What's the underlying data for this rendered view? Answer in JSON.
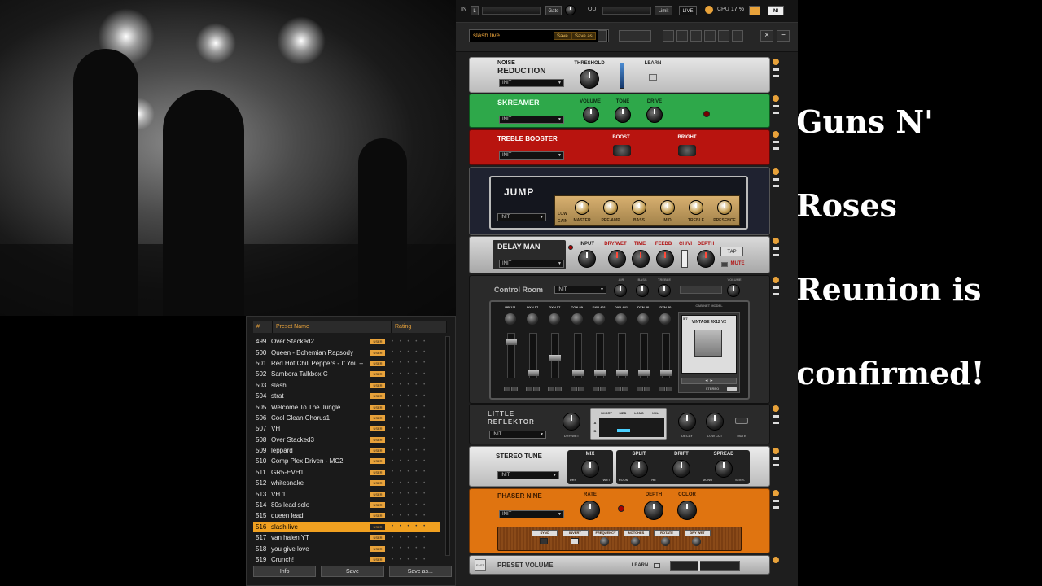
{
  "headline": {
    "lines": [
      "Guns N'",
      "Roses",
      "Reunion is",
      "confirmed!"
    ]
  },
  "topbar": {
    "in_label": "IN",
    "in_channel": "L",
    "gate_label": "Gate",
    "out_label": "OUT",
    "limit_label": "Limit",
    "live_label": "LIVE",
    "cpu_label": "CPU",
    "cpu_value": "17 %",
    "logo": "NI"
  },
  "preset_bar": {
    "preset_name": "slash live",
    "save_label": "Save",
    "save_as_label": "Save as"
  },
  "browser": {
    "col_num": "#",
    "col_name": "Preset Name",
    "col_rating": "Rating",
    "user_tag": "USER",
    "rating_dots": "• • • • •",
    "selected_index": 17,
    "rows": [
      {
        "num": "499",
        "name": "Over Stacked2"
      },
      {
        "num": "500",
        "name": "Queen - Bohemian Rapsody"
      },
      {
        "num": "501",
        "name": "Red Hot Chili Peppers - If You –"
      },
      {
        "num": "502",
        "name": "Sambora Talkbox        C"
      },
      {
        "num": "503",
        "name": "slash"
      },
      {
        "num": "504",
        "name": "strat"
      },
      {
        "num": "505",
        "name": "Welcome To The Jungle"
      },
      {
        "num": "506",
        "name": "Cool Clean Chorus1"
      },
      {
        "num": "507",
        "name": "VH¨"
      },
      {
        "num": "508",
        "name": "Over Stacked3"
      },
      {
        "num": "509",
        "name": "leppard"
      },
      {
        "num": "510",
        "name": "Comp Plex Driven - MC2"
      },
      {
        "num": "511",
        "name": "GR5-EVH1"
      },
      {
        "num": "512",
        "name": "whitesnake"
      },
      {
        "num": "513",
        "name": "VH¨1"
      },
      {
        "num": "514",
        "name": "80s lead solo"
      },
      {
        "num": "515",
        "name": "queen lead"
      },
      {
        "num": "516",
        "name": "slash live"
      },
      {
        "num": "517",
        "name": "van halen YT"
      },
      {
        "num": "518",
        "name": "you give love"
      },
      {
        "num": "519",
        "name": "Crunch!"
      }
    ],
    "footer": {
      "info": "Info",
      "save": "Save",
      "save_as": "Save as..."
    }
  },
  "modules": {
    "noise": {
      "title1": "NOISE",
      "title2": "REDUCTION",
      "preset": "INIT",
      "k1": "THRESHOLD",
      "learn": "LEARN"
    },
    "skreamer": {
      "title": "SKREAMER",
      "preset": "INIT",
      "k1": "VOLUME",
      "k2": "TONE",
      "k3": "DRIVE"
    },
    "treble": {
      "title": "TREBLE BOOSTER",
      "preset": "INIT",
      "k1": "BOOST",
      "k2": "BRIGHT"
    },
    "jump": {
      "title": "JUMP",
      "preset": "INIT",
      "low": "LOW",
      "gain": "GAIN",
      "k1": "MASTER",
      "k2": "PRE-AMP",
      "k3": "BASS",
      "k4": "MID",
      "k5": "TREBLE",
      "k6": "PRESENCE"
    },
    "delay": {
      "title": "DELAY MAN",
      "preset": "INIT",
      "k0": "INPUT",
      "k1": "DRY/WET",
      "k2": "TIME",
      "k3": "FEEDB",
      "k4": "CH/VI",
      "k5": "DEPTH",
      "tap": "TAP",
      "mute": "MUTE"
    },
    "control": {
      "title": "Control Room",
      "preset": "INIT",
      "k1": "AIR",
      "k2": "BASS",
      "k3": "TREBLE",
      "k4": "VOLUME",
      "channels": [
        "RB 121",
        "DYN 57",
        "DYN 57",
        "CON 89",
        "DYN 421",
        "DYN 441",
        "DYN 80",
        "DYN 40"
      ],
      "cabinet_title": "CABINET MODEL",
      "cabinet_num": "5/7",
      "cabinet_name": "VINTAGE 4X12 V2",
      "stereo": "STEREO"
    },
    "reflektor": {
      "title1": "LITTLE",
      "title2": "REFLEKTOR",
      "preset": "INIT",
      "k1": "DRY/WET",
      "t1": "SHORT",
      "t2": "MED",
      "t3": "LONG",
      "t4": "XXL",
      "rowA": "A",
      "rowB": "B",
      "k2": "DECAY",
      "k3": "LOW CUT",
      "mute": "MUTE"
    },
    "stereo": {
      "title": "STEREO TUNE",
      "preset": "INIT",
      "k1": "MIX",
      "k2": "SPLIT",
      "k3": "DRIFT",
      "k4": "SPREAD",
      "dry": "DRY",
      "wet": "WET",
      "wide": "WIDE",
      "mono": "MONO",
      "ster": "STER.",
      "rooms": "ROOM",
      "hall": "HE"
    },
    "phaser": {
      "title": "PHASER NINE",
      "preset": "INIT",
      "k1": "RATE",
      "k2": "DEPTH",
      "k3": "COLOR",
      "b1": "SYNC",
      "b2": "INVERT",
      "b3": "FREQUENCY",
      "b4": "NOTCHES",
      "b5": "ROTATE",
      "b6": "DRY WET"
    },
    "volume": {
      "title": "PRESET VOLUME",
      "learn": "LEARN",
      "fast": "FAST"
    }
  },
  "colors": {
    "accent": "#e8a23a",
    "skreamer": "#2ea84a",
    "treble": "#b8140f",
    "delay": "#c9c9c9",
    "phaser": "#e07410",
    "stereo": "#d8d8d8"
  }
}
